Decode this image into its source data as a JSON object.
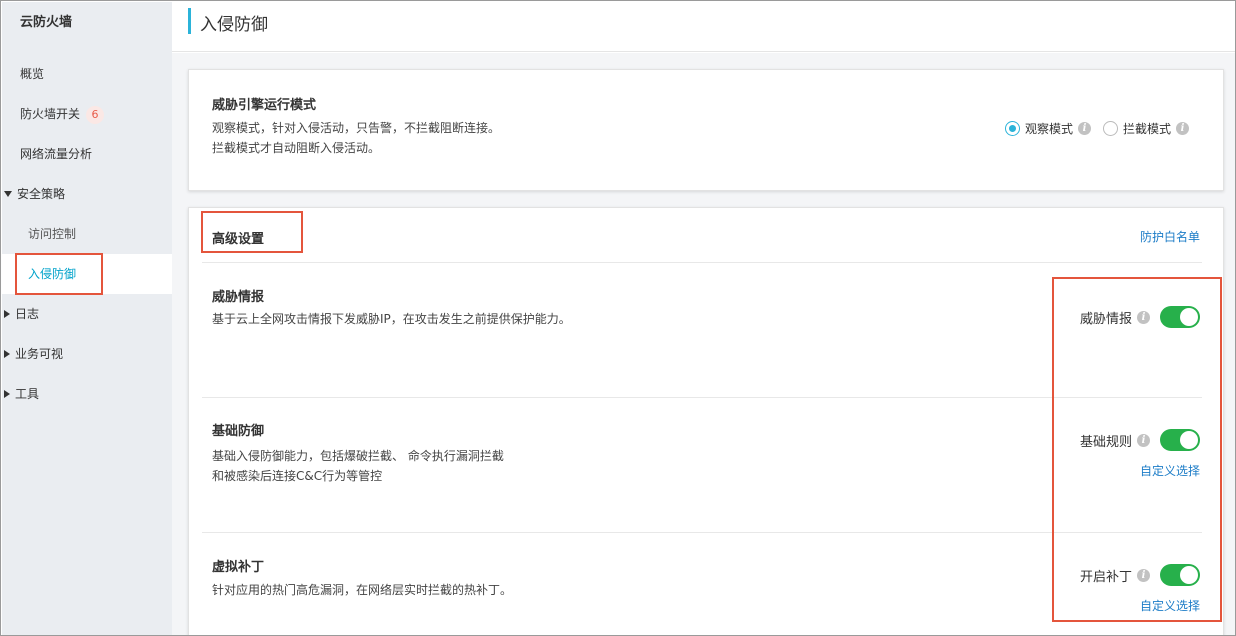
{
  "sidebar": {
    "title": "云防火墙",
    "items": [
      {
        "label": "概览"
      },
      {
        "label": "防火墙开关",
        "badge": "6"
      },
      {
        "label": "网络流量分析"
      },
      {
        "label": "安全策略"
      },
      {
        "label": "访问控制"
      },
      {
        "label": "入侵防御"
      },
      {
        "label": "日志"
      },
      {
        "label": "业务可视"
      },
      {
        "label": "工具"
      }
    ]
  },
  "header": {
    "title": "入侵防御"
  },
  "engine_mode": {
    "title": "威胁引擎运行模式",
    "desc_line1": "观察模式，针对入侵活动，只告警，不拦截阻断连接。",
    "desc_line2": "拦截模式才自动阻断入侵活动。",
    "options": [
      {
        "label": "观察模式",
        "selected": true
      },
      {
        "label": "拦截模式",
        "selected": false
      }
    ]
  },
  "advanced": {
    "title": "高级设置",
    "whitelist_link": "防护白名单",
    "sections": [
      {
        "title": "威胁情报",
        "desc_line1": "基于云上全网攻击情报下发威胁IP，在攻击发生之前提供保护能力。",
        "desc_line2": "",
        "toggle_label": "威胁情报",
        "toggle_on": true,
        "link": ""
      },
      {
        "title": "基础防御",
        "desc_line1": "基础入侵防御能力，包括爆破拦截、 命令执行漏洞拦截",
        "desc_line2": "和被感染后连接C&C行为等管控",
        "toggle_label": "基础规则",
        "toggle_on": true,
        "link": "自定义选择"
      },
      {
        "title": "虚拟补丁",
        "desc_line1": "针对应用的热门高危漏洞，在网络层实时拦截的热补丁。",
        "desc_line2": "",
        "toggle_label": "开启补丁",
        "toggle_on": true,
        "link": "自定义选择"
      }
    ]
  },
  "colors": {
    "accent": "#2bb3d9",
    "toggle_on": "#27b04b",
    "link": "#1c7cc7",
    "highlight_box": "#e4553c"
  }
}
